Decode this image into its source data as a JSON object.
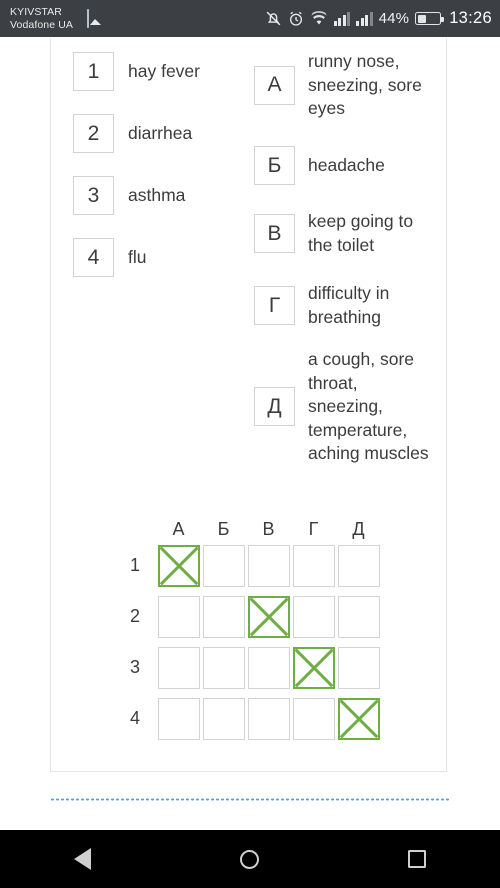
{
  "status_bar": {
    "carrier_line1": "KYIVSTAR",
    "carrier_line2": "Vodafone UA",
    "icons": [
      "moon-icon",
      "screenshot-icon",
      "bell-muted-icon",
      "alarm-icon",
      "wifi-icon",
      "signal-icon",
      "signal-icon"
    ],
    "battery_percent": "44%",
    "battery_level": 40,
    "time": "13:26"
  },
  "exercise": {
    "stems": [
      {
        "num": "1",
        "text": "hay fever"
      },
      {
        "num": "2",
        "text": "diarrhea"
      },
      {
        "num": "3",
        "text": "asthma"
      },
      {
        "num": "4",
        "text": "flu"
      }
    ],
    "options": [
      {
        "letter": "А",
        "text": "runny nose, sneezing, sore eyes"
      },
      {
        "letter": "Б",
        "text": "headache"
      },
      {
        "letter": "В",
        "text": "keep going to the toilet"
      },
      {
        "letter": "Г",
        "text": "difficulty in breathing"
      },
      {
        "letter": "Д",
        "text": "a cough, sore throat, sneezing, temperature, aching muscles"
      }
    ],
    "answer_grid": {
      "columns": [
        "А",
        "Б",
        "В",
        "Г",
        "Д"
      ],
      "rows": [
        "1",
        "2",
        "3",
        "4"
      ],
      "selected": [
        0,
        2,
        3,
        4
      ],
      "marked_color": "#6fae44"
    }
  },
  "nav_bar": {
    "back_label": "back-icon",
    "home_label": "home-icon",
    "recents_label": "recents-icon"
  }
}
